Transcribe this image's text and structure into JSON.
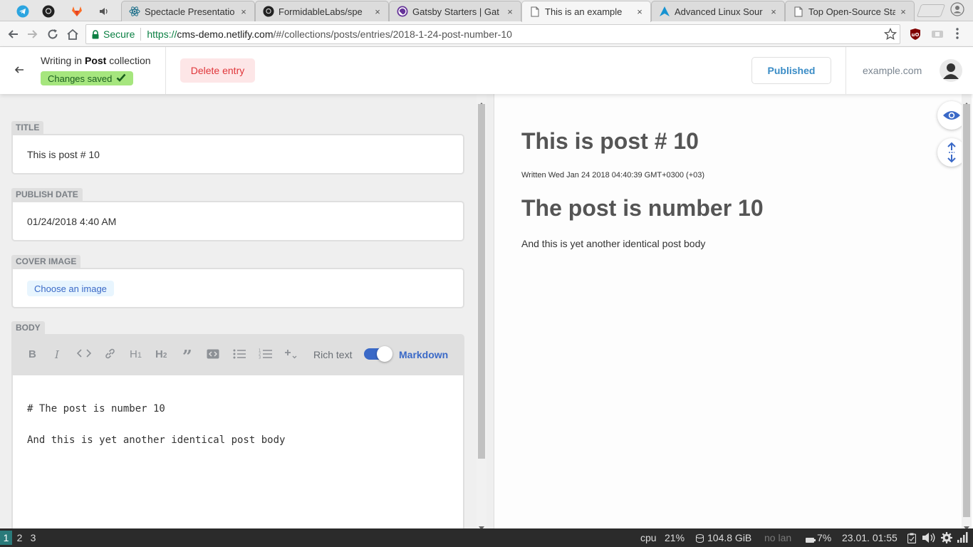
{
  "browser": {
    "pinned_tabs": [
      {
        "icon": "telegram-icon"
      },
      {
        "icon": "github-icon"
      },
      {
        "icon": "gitlab-icon"
      },
      {
        "icon": "speaker-icon"
      }
    ],
    "tabs": [
      {
        "title": "Spectacle Presentatio",
        "icon": "react-icon"
      },
      {
        "title": "FormidableLabs/spe",
        "icon": "github-icon"
      },
      {
        "title": "Gatsby Starters | Gat",
        "icon": "gatsby-icon"
      },
      {
        "title": "This is an example",
        "icon": "page-icon",
        "active": true
      },
      {
        "title": "Advanced Linux Sour",
        "icon": "arch-icon"
      },
      {
        "title": "Top Open-Source Sta",
        "icon": "page-icon"
      }
    ],
    "close_glyph": "×",
    "secure_label": "Secure",
    "url_scheme": "https://",
    "url_domain": "cms-demo.netlify.com",
    "url_path": "/#/collections/posts/entries/2018-1-24-post-number-10"
  },
  "header": {
    "writing_prefix": "Writing in ",
    "collection": "Post",
    "writing_suffix": " collection",
    "status": "Changes saved",
    "delete_label": "Delete entry",
    "publish_label": "Published",
    "site": "example.com"
  },
  "editor": {
    "fields": {
      "title_label": "TITLE",
      "title_value": "This is post # 10",
      "date_label": "PUBLISH DATE",
      "date_value": "01/24/2018 4:40 AM",
      "image_label": "COVER IMAGE",
      "image_button": "Choose an image",
      "body_label": "BODY"
    },
    "toolbar": {
      "rich_text": "Rich text",
      "markdown": "Markdown",
      "markdown_enabled": true
    },
    "body_lines": [
      "# The post is number 10",
      "And this is yet another identical post body"
    ]
  },
  "preview": {
    "title": "This is post # 10",
    "written": "Written Wed Jan 24 2018 04:40:39 GMT+0300 (+03)",
    "heading": "The post is number 10",
    "body": "And this is yet another identical post body"
  },
  "os_bar": {
    "workspaces": [
      "1",
      "2",
      "3"
    ],
    "active_workspace": "1",
    "cpu_label": "cpu",
    "cpu_value": "21%",
    "disk": "104.8 GiB",
    "network": "no lan",
    "battery": "7%",
    "datetime": "23.01. 01:55"
  },
  "colors": {
    "accent": "#3a69c7",
    "saved_bg": "#a6e67e",
    "delete_text": "#e0363a",
    "published_text": "#3a8cc6"
  }
}
